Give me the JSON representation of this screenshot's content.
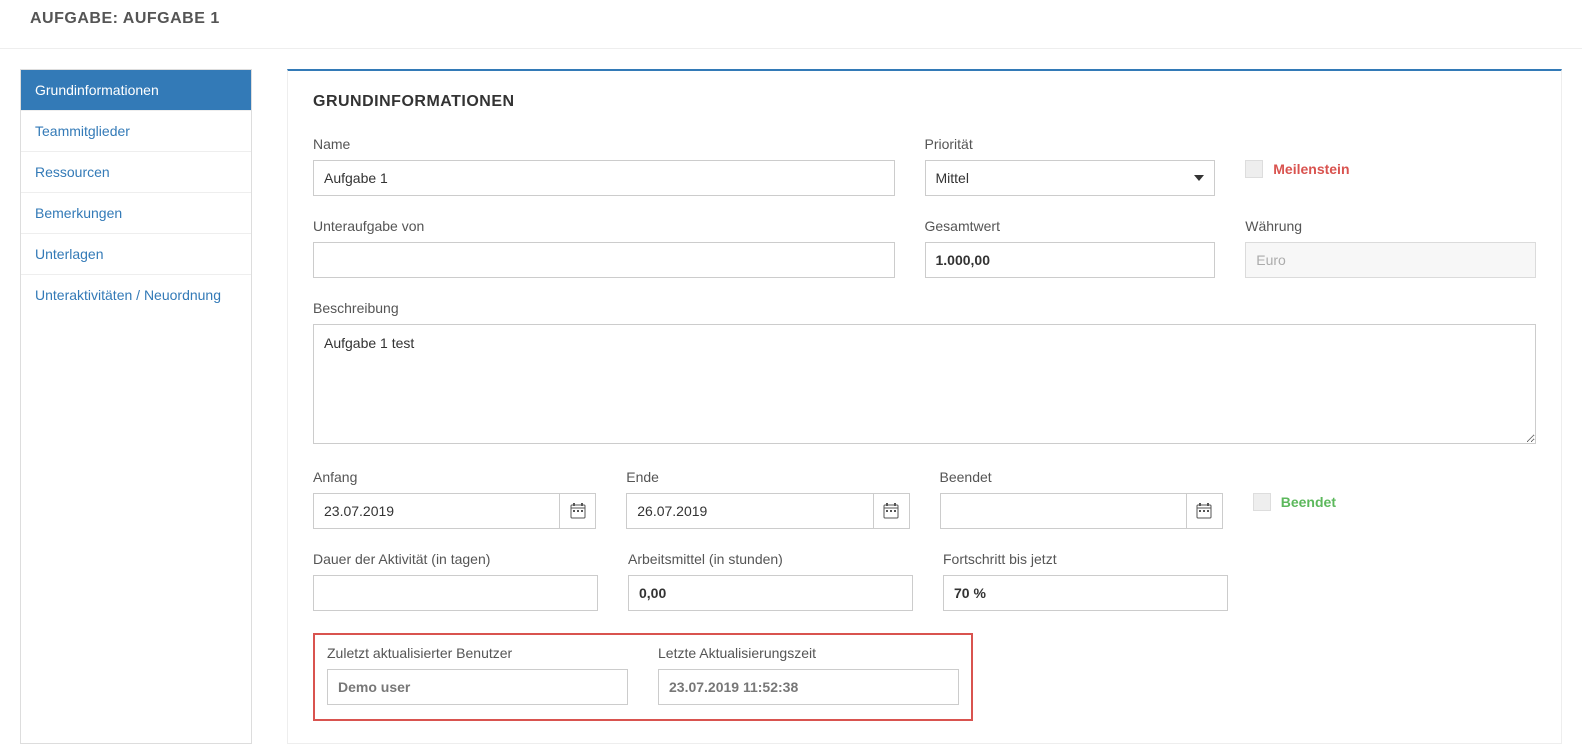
{
  "header": {
    "title": "AUFGABE: AUFGABE 1"
  },
  "sidebar": {
    "items": [
      {
        "label": "Grundinformationen",
        "active": true
      },
      {
        "label": "Teammitglieder",
        "active": false
      },
      {
        "label": "Ressourcen",
        "active": false
      },
      {
        "label": "Bemerkungen",
        "active": false
      },
      {
        "label": "Unterlagen",
        "active": false
      },
      {
        "label": "Unteraktivitäten / Neuordnung",
        "active": false
      }
    ]
  },
  "section": {
    "title": "GRUNDINFORMATIONEN"
  },
  "labels": {
    "name": "Name",
    "priority": "Priorität",
    "milestone": "Meilenstein",
    "subtask_of": "Unteraufgabe von",
    "total_value": "Gesamtwert",
    "currency": "Währung",
    "description": "Beschreibung",
    "start": "Anfang",
    "end": "Ende",
    "finished_date": "Beendet",
    "finished_flag": "Beendet",
    "duration": "Dauer der Aktivität (in tagen)",
    "effort": "Arbeitsmittel (in stunden)",
    "progress": "Fortschritt bis jetzt",
    "last_user": "Zuletzt aktualisierter Benutzer",
    "last_time": "Letzte Aktualisierungszeit"
  },
  "values": {
    "name": "Aufgabe 1",
    "priority": "Mittel",
    "subtask_of": "",
    "total_value": "1.000,00",
    "currency": "Euro",
    "description": "Aufgabe 1 test",
    "start": "23.07.2019",
    "end": "26.07.2019",
    "finished_date": "",
    "duration": "",
    "effort": "0,00",
    "progress": "70 %",
    "last_user": "Demo user",
    "last_time": "23.07.2019 11:52:38"
  }
}
